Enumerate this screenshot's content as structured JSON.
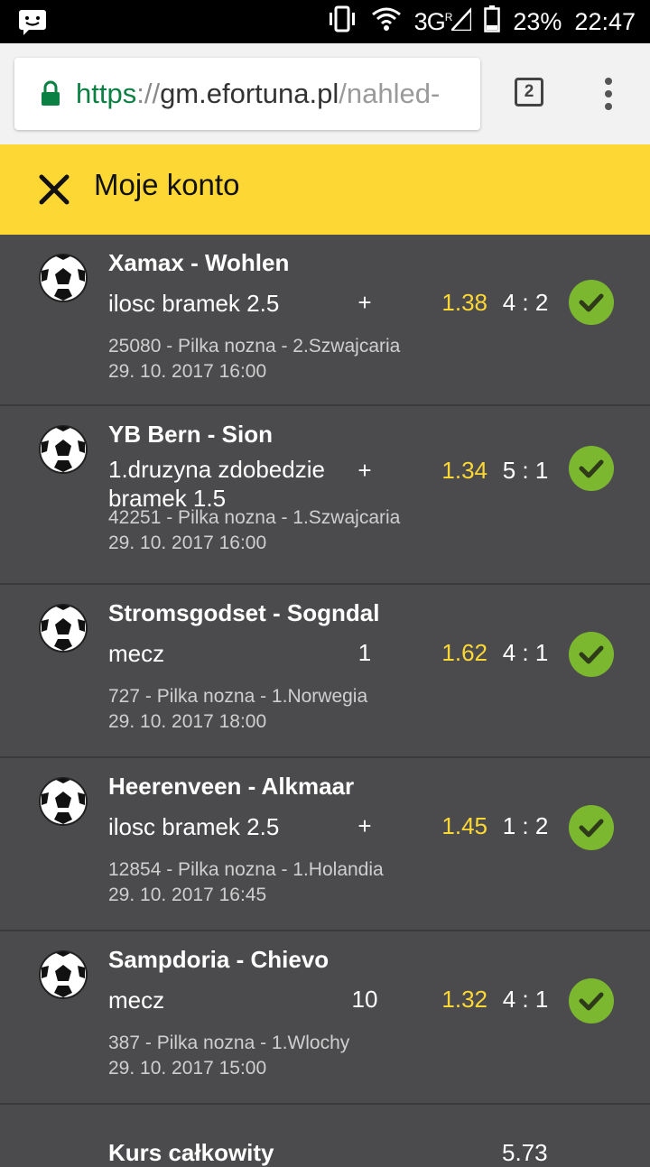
{
  "status_bar": {
    "network": "3G",
    "network_sup": "R",
    "battery": "23%",
    "time": "22:47"
  },
  "browser": {
    "url_scheme": "https",
    "url_sep": "://",
    "url_host": "gm.efortuna.pl",
    "url_path": "/nahled-",
    "tab_count": "2"
  },
  "header": {
    "title": "Moje konto"
  },
  "bets": [
    {
      "teams": "Xamax - Wohlen",
      "market": "ilosc bramek 2.5",
      "pick": "+",
      "odds": "1.38",
      "score": "4 : 2",
      "info": "25080 - Pilka nozna - 2.Szwajcaria",
      "datetime": "29. 10. 2017 16:00"
    },
    {
      "teams": "YB Bern - Sion",
      "market": "1.druzyna zdobedzie bramek 1.5",
      "pick": "+",
      "odds": "1.34",
      "score": "5 : 1",
      "info": "42251 - Pilka nozna - 1.Szwajcaria",
      "datetime": "29. 10. 2017 16:00"
    },
    {
      "teams": "Stromsgodset - Sogndal",
      "market": "mecz",
      "pick": "1",
      "odds": "1.62",
      "score": "4 : 1",
      "info": "727 - Pilka nozna - 1.Norwegia",
      "datetime": "29. 10. 2017 18:00"
    },
    {
      "teams": "Heerenveen - Alkmaar",
      "market": "ilosc bramek 2.5",
      "pick": "+",
      "odds": "1.45",
      "score": "1 : 2",
      "info": "12854 - Pilka nozna - 1.Holandia",
      "datetime": "29. 10. 2017 16:45"
    },
    {
      "teams": "Sampdoria - Chievo",
      "market": "mecz",
      "pick": "10",
      "odds": "1.32",
      "score": "4 : 1",
      "info": "387 - Pilka nozna - 1.Wlochy",
      "datetime": "29. 10. 2017 15:00"
    }
  ],
  "total": {
    "label": "Kurs całkowity",
    "value": "5.73"
  },
  "colors": {
    "accent_yellow": "#fdd835",
    "list_bg": "#4b4b4d",
    "win_green": "#7cb82f"
  }
}
